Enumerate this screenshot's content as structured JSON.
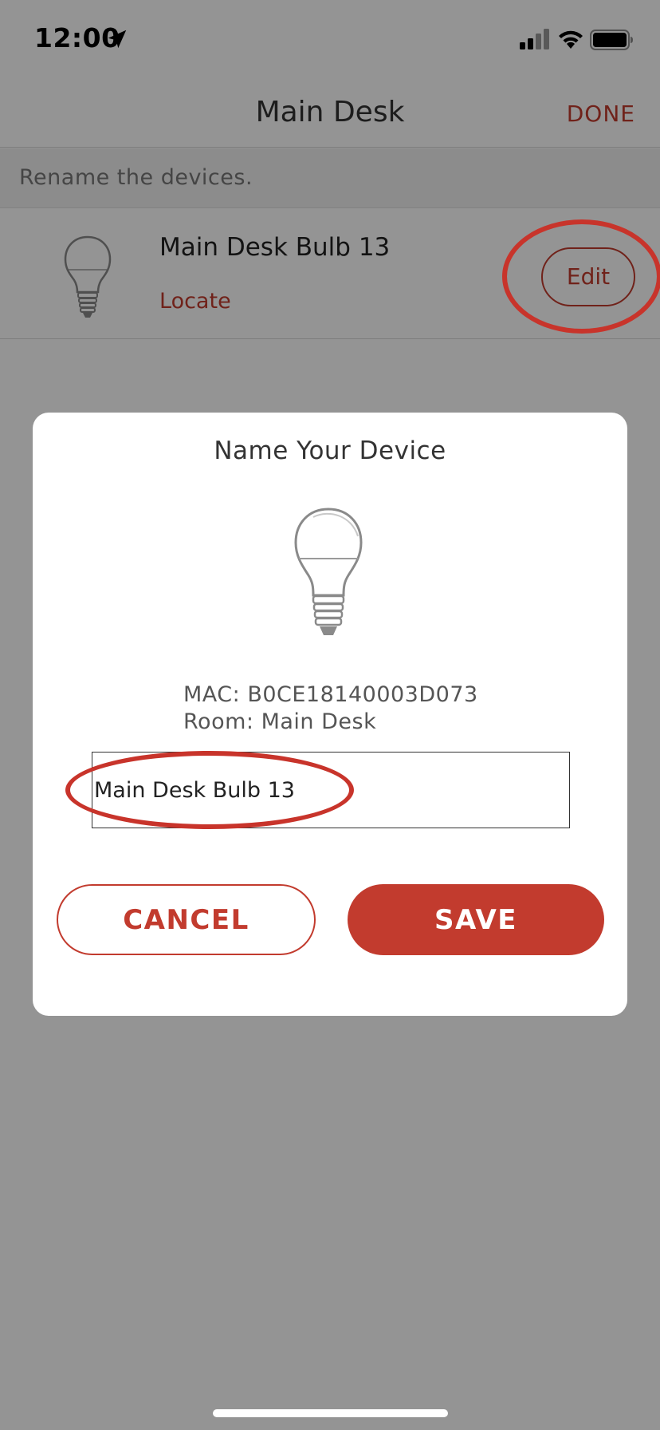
{
  "status_bar": {
    "time": "12:00",
    "icons": [
      "location-arrow-icon",
      "cellular-signal-icon",
      "wifi-icon",
      "battery-icon"
    ]
  },
  "nav": {
    "title": "Main Desk",
    "done_label": "DONE"
  },
  "hint": "Rename the devices.",
  "device": {
    "name": "Main Desk Bulb 13",
    "locate_label": "Locate",
    "edit_label": "Edit",
    "icon": "light-bulb-icon"
  },
  "modal": {
    "title": "Name Your Device",
    "icon": "light-bulb-icon",
    "mac_line": "MAC: B0CE18140003D073",
    "room_line": "Room: Main Desk",
    "name_value": "Main Desk Bulb 13",
    "cancel_label": "CANCEL",
    "save_label": "SAVE"
  },
  "colors": {
    "accent": "#c23b2e",
    "annotation": "#c8342b",
    "overlay": "rgba(0,0,0,0.42)"
  }
}
